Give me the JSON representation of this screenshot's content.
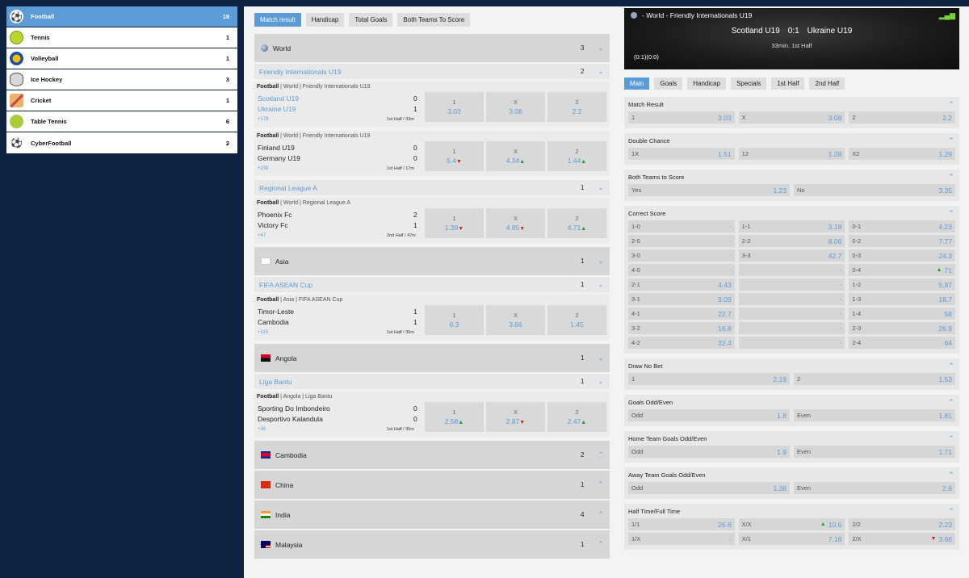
{
  "sports": [
    {
      "name": "Football",
      "count": "18",
      "icon": "soccer-ball-icon",
      "active": true
    },
    {
      "name": "Tennis",
      "count": "1",
      "icon": "tennis-ball-icon"
    },
    {
      "name": "Volleyball",
      "count": "1",
      "icon": "volleyball-icon"
    },
    {
      "name": "Ice Hockey",
      "count": "3",
      "icon": "hockey-puck-icon"
    },
    {
      "name": "Cricket",
      "count": "1",
      "icon": "cricket-bat-icon"
    },
    {
      "name": "Table Tennis",
      "count": "6",
      "icon": "table-tennis-icon"
    },
    {
      "name": "CyberFootball",
      "count": "2",
      "icon": "cyber-football-icon"
    }
  ],
  "market_tabs": [
    "Match result",
    "Handicap",
    "Total Goals",
    "Both Teams To Score"
  ],
  "center": {
    "world": {
      "name": "World",
      "count": "3"
    },
    "league_friendly": {
      "name": "Friendly Internationals U19",
      "count": "2"
    },
    "m1": {
      "sport": "Football",
      "crumb": " | World | Friendly Internationals U19",
      "team1": "Scotland U19",
      "team2": "Ukraine U19",
      "s1": "0",
      "s2": "1",
      "more": "+178",
      "time": "1st Half / 33m",
      "o1": "3.03",
      "ox": "3.08",
      "o2": "2.2"
    },
    "m2": {
      "sport": "Football",
      "crumb": " | World | Friendly Internationals U19",
      "team1": "Finland U19",
      "team2": "Germany U19",
      "s1": "0",
      "s2": "0",
      "more": "+239",
      "time": "1st Half / 17m",
      "o1": "5.4",
      "ox": "4.34",
      "o2": "1.44"
    },
    "league_regional": {
      "name": "Regional League A",
      "count": "1"
    },
    "m3": {
      "sport": "Football",
      "crumb": " | World | Regional League A",
      "team1": "Phoenix Fc",
      "team2": "Victory Fc",
      "s1": "2",
      "s2": "1",
      "more": "+47",
      "time": "2nd Half / 47m",
      "o1": "1.39",
      "ox": "4.85",
      "o2": "4.71"
    },
    "asia": {
      "name": "Asia",
      "count": "1"
    },
    "league_asean": {
      "name": "FIFA ASEAN Cup",
      "count": "1"
    },
    "m4": {
      "sport": "Football",
      "crumb": " | Asia | FIFA ASEAN Cup",
      "team1": "Timor-Leste",
      "team2": "Cambodia",
      "s1": "1",
      "s2": "1",
      "more": "+115",
      "time": "1st Half / 35m",
      "o1": "6.3",
      "ox": "3.66",
      "o2": "1.45"
    },
    "angola": {
      "name": "Angola",
      "count": "1"
    },
    "league_bantu": {
      "name": "Liga Bantu",
      "count": "1"
    },
    "m5": {
      "sport": "Football",
      "crumb": " | Angola | Liga Bantu",
      "team1": "Sporting Do Imbondeiro",
      "team2": "Desportivo Kalandula",
      "s1": "0",
      "s2": "0",
      "more": "+36",
      "time": "1st Half / 35m",
      "o1": "2.58",
      "ox": "2.87",
      "o2": "2.47"
    },
    "cambodia": {
      "name": "Cambodia",
      "count": "2"
    },
    "china": {
      "name": "China",
      "count": "1"
    },
    "india": {
      "name": "India",
      "count": "4"
    },
    "malaysia": {
      "name": "Malaysia",
      "count": "1"
    },
    "odd_labels": {
      "one": "1",
      "x": "X",
      "two": "2"
    }
  },
  "event": {
    "title": "- World - Friendly Internationals U19",
    "home": "Scotland U19",
    "score": "0:1",
    "away": "Ukraine U19",
    "minute": "33min. 1st Half",
    "halfscores": "(0:1)(0:0)",
    "signal_icon": "signal-bars-icon"
  },
  "detail_tabs": [
    "Main",
    "Goals",
    "Handicap",
    "Specials",
    "1st Half",
    "2nd Half"
  ],
  "markets": {
    "match_result": {
      "title": "Match Result",
      "a": {
        "l": "1",
        "v": "3.03"
      },
      "b": {
        "l": "X",
        "v": "3.08"
      },
      "c": {
        "l": "2",
        "v": "2.2"
      }
    },
    "double_chance": {
      "title": "Double Chance",
      "a": {
        "l": "1X",
        "v": "1.51"
      },
      "b": {
        "l": "12",
        "v": "1.28"
      },
      "c": {
        "l": "X2",
        "v": "1.29"
      }
    },
    "btts": {
      "title": "Both Teams to Score",
      "a": {
        "l": "Yes",
        "v": "1.23"
      },
      "b": {
        "l": "No",
        "v": "3.35"
      }
    },
    "correct_score": {
      "title": "Correct Score",
      "rows": [
        [
          {
            "l": "1-0",
            "v": "-"
          },
          {
            "l": "1-1",
            "v": "3.19"
          },
          {
            "l": "0-1",
            "v": "4.23"
          }
        ],
        [
          {
            "l": "2-0",
            "v": "-"
          },
          {
            "l": "2-2",
            "v": "8.06"
          },
          {
            "l": "0-2",
            "v": "7.77"
          }
        ],
        [
          {
            "l": "3-0",
            "v": "-"
          },
          {
            "l": "3-3",
            "v": "42.7"
          },
          {
            "l": "0-3",
            "v": "24.3"
          }
        ],
        [
          {
            "l": "4-0",
            "v": "-"
          },
          {
            "l": "",
            "v": "-"
          },
          {
            "l": "0-4",
            "v": "71"
          }
        ],
        [
          {
            "l": "2-1",
            "v": "4.43"
          },
          {
            "l": "",
            "v": "-"
          },
          {
            "l": "1-2",
            "v": "5.87"
          }
        ],
        [
          {
            "l": "3-1",
            "v": "9.09"
          },
          {
            "l": "",
            "v": "-"
          },
          {
            "l": "1-3",
            "v": "18.7"
          }
        ],
        [
          {
            "l": "4-1",
            "v": "22.7"
          },
          {
            "l": "",
            "v": "-"
          },
          {
            "l": "1-4",
            "v": "58"
          }
        ],
        [
          {
            "l": "3-2",
            "v": "16.8"
          },
          {
            "l": "",
            "v": "-"
          },
          {
            "l": "2-3",
            "v": "26.9"
          }
        ],
        [
          {
            "l": "4-2",
            "v": "32.4"
          },
          {
            "l": "",
            "v": "-"
          },
          {
            "l": "2-4",
            "v": "64"
          }
        ]
      ]
    },
    "draw_no_bet": {
      "title": "Draw No Bet",
      "a": {
        "l": "1",
        "v": "2.19"
      },
      "b": {
        "l": "2",
        "v": "1.53"
      }
    },
    "goals_odd_even": {
      "title": "Goals Odd/Even",
      "a": {
        "l": "Odd",
        "v": "1.8"
      },
      "b": {
        "l": "Even",
        "v": "1.81"
      }
    },
    "home_odd_even": {
      "title": "Home Team Goals Odd/Even",
      "a": {
        "l": "Odd",
        "v": "1.9"
      },
      "b": {
        "l": "Even",
        "v": "1.71"
      }
    },
    "away_odd_even": {
      "title": "Away Team Goals Odd/Even",
      "a": {
        "l": "Odd",
        "v": "1.38"
      },
      "b": {
        "l": "Even",
        "v": "2.6"
      }
    },
    "htft": {
      "title": "Half Time/Full Time",
      "r1": [
        {
          "l": "1/1",
          "v": "26.8"
        },
        {
          "l": "X/X",
          "v": "10.6"
        },
        {
          "l": "2/2",
          "v": "2.23"
        }
      ],
      "r2": [
        {
          "l": "1/X",
          "v": "-"
        },
        {
          "l": "X/1",
          "v": "7.18"
        },
        {
          "l": "2/X",
          "v": "3.66"
        }
      ]
    }
  }
}
